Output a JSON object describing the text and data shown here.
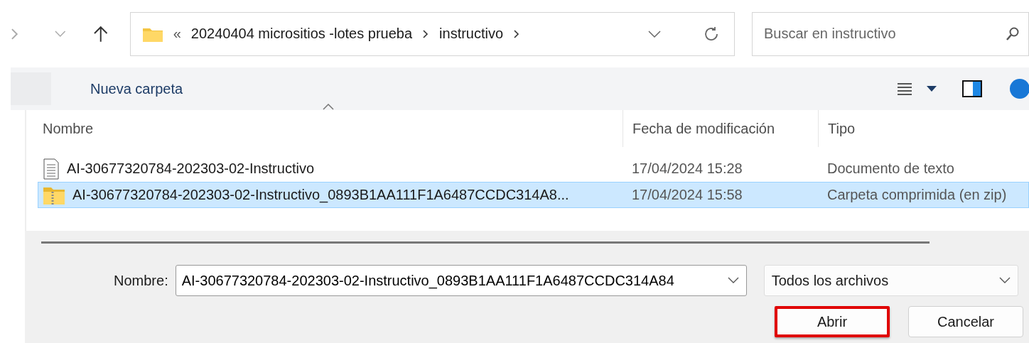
{
  "address_bar": {
    "overflow": "«",
    "path": [
      "20240404 micrositios -lotes prueba",
      "instructivo"
    ]
  },
  "search": {
    "placeholder": "Buscar en instructivo"
  },
  "toolbar": {
    "new_folder": "Nueva carpeta"
  },
  "table": {
    "columns": [
      "Nombre",
      "Fecha de modificación",
      "Tipo"
    ],
    "rows": [
      {
        "kind": "text",
        "name": "AI-30677320784-202303-02-Instructivo",
        "date": "17/04/2024 15:28",
        "type": "Documento de texto",
        "selected": false
      },
      {
        "kind": "zip",
        "name": "AI-30677320784-202303-02-Instructivo_0893B1AA111F1A6487CCDC314A8...",
        "date": "17/04/2024 15:58",
        "type": "Carpeta comprimida (en zip)",
        "selected": true
      }
    ]
  },
  "footer": {
    "name_label": "Nombre:",
    "name_value": "AI-30677320784-202303-02-Instructivo_0893B1AA111F1A6487CCDC314A84",
    "filter": "Todos los archivos",
    "buttons": [
      {
        "label": "Abrir",
        "highlighted": true
      },
      {
        "label": "Cancelar",
        "highlighted": false
      }
    ]
  }
}
